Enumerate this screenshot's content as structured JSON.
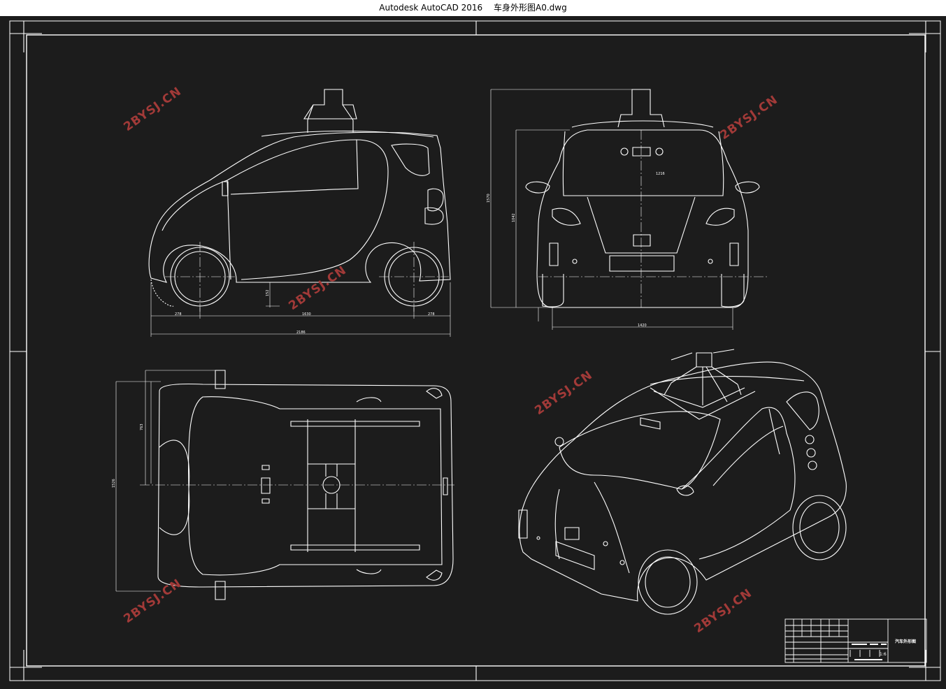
{
  "window": {
    "app_title": "Autodesk AutoCAD 2016",
    "file_name": "车身外形图A0.dwg"
  },
  "watermarks": {
    "text": "2BYSJ.CN"
  },
  "dimensions": {
    "side_front_overhang": "278",
    "side_wheelbase": "1630",
    "side_rear_overhang": "278",
    "side_total_length": "2186",
    "side_ground_clearance": "152",
    "front_total_height": "1570",
    "front_mid_height": "1042",
    "front_roof_width": "1216",
    "front_track_width": "1420",
    "top_half_width": "763",
    "top_total_width": "1526"
  },
  "title_block": {
    "drawing_name": "汽车外形图",
    "scale": "1:6"
  },
  "colors": {
    "background": "#1c1c1c",
    "line": "#ffffff",
    "watermark": "#a23a38"
  }
}
